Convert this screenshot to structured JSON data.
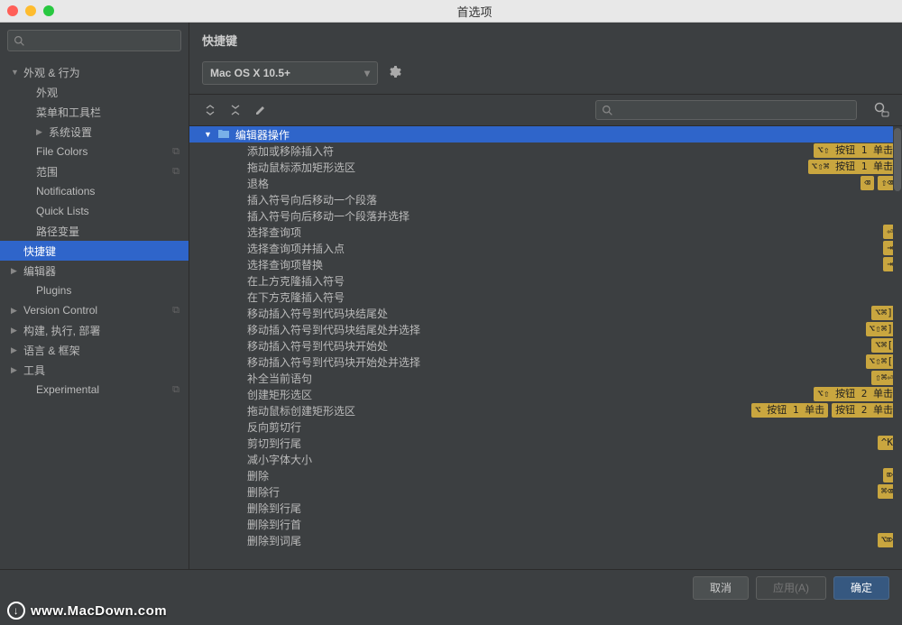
{
  "window": {
    "title": "首选项"
  },
  "sidebar": {
    "search_placeholder": "",
    "items": [
      {
        "label": "外观 & 行为",
        "arrow": "expanded",
        "level": 0
      },
      {
        "label": "外观",
        "level": 1
      },
      {
        "label": "菜单和工具栏",
        "level": 1
      },
      {
        "label": "系统设置",
        "arrow": "collapsed",
        "level": 1
      },
      {
        "label": "File Colors",
        "level": 1,
        "badge": "⧉"
      },
      {
        "label": "范围",
        "level": 1,
        "badge": "⧉"
      },
      {
        "label": "Notifications",
        "level": 1
      },
      {
        "label": "Quick Lists",
        "level": 1
      },
      {
        "label": "路径变量",
        "level": 1
      },
      {
        "label": "快捷键",
        "level": 0,
        "selected": true
      },
      {
        "label": "编辑器",
        "arrow": "collapsed",
        "level": 0
      },
      {
        "label": "Plugins",
        "level": 1
      },
      {
        "label": "Version Control",
        "arrow": "collapsed",
        "level": 0,
        "badge": "⧉"
      },
      {
        "label": "构建, 执行, 部署",
        "arrow": "collapsed",
        "level": 0
      },
      {
        "label": "语言 & 框架",
        "arrow": "collapsed",
        "level": 0
      },
      {
        "label": "工具",
        "arrow": "collapsed",
        "level": 0
      },
      {
        "label": "Experimental",
        "level": 1,
        "badge": "⧉"
      }
    ]
  },
  "content": {
    "title": "快捷键",
    "keymap_scheme": "Mac OS X 10.5+",
    "actions_search_placeholder": "",
    "group_label": "编辑器操作",
    "actions": [
      {
        "label": "添加或移除插入符",
        "shortcuts": [
          "⌥⇧ 按钮 1 单击"
        ]
      },
      {
        "label": "拖动鼠标添加矩形选区",
        "shortcuts": [
          "⌥⇧⌘ 按钮 1 单击"
        ]
      },
      {
        "label": "退格",
        "shortcuts": [
          "⌫",
          "⇧⌫"
        ]
      },
      {
        "label": "插入符号向后移动一个段落",
        "shortcuts": []
      },
      {
        "label": "插入符号向后移动一个段落并选择",
        "shortcuts": []
      },
      {
        "label": "选择查询项",
        "shortcuts": [
          "⏎"
        ]
      },
      {
        "label": "选择查询项并插入点",
        "shortcuts": [
          "⇥"
        ]
      },
      {
        "label": "选择查询项替换",
        "shortcuts": [
          "⇥"
        ]
      },
      {
        "label": "在上方克隆插入符号",
        "shortcuts": []
      },
      {
        "label": "在下方克隆插入符号",
        "shortcuts": []
      },
      {
        "label": "移动插入符号到代码块结尾处",
        "shortcuts": [
          "⌥⌘]"
        ]
      },
      {
        "label": "移动插入符号到代码块结尾处并选择",
        "shortcuts": [
          "⌥⇧⌘]"
        ]
      },
      {
        "label": "移动插入符号到代码块开始处",
        "shortcuts": [
          "⌥⌘["
        ]
      },
      {
        "label": "移动插入符号到代码块开始处并选择",
        "shortcuts": [
          "⌥⇧⌘["
        ]
      },
      {
        "label": "补全当前语句",
        "shortcuts": [
          "⇧⌘⏎"
        ]
      },
      {
        "label": "创建矩形选区",
        "shortcuts": [
          "⌥⇧ 按钮 2 单击"
        ]
      },
      {
        "label": "拖动鼠标创建矩形选区",
        "shortcuts": [
          "⌥ 按钮 1 单击",
          "按钮 2 单击"
        ]
      },
      {
        "label": "反向剪切行",
        "shortcuts": []
      },
      {
        "label": "剪切到行尾",
        "shortcuts": [
          "^K"
        ]
      },
      {
        "label": "减小字体大小",
        "shortcuts": []
      },
      {
        "label": "删除",
        "shortcuts": [
          "⌦"
        ]
      },
      {
        "label": "删除行",
        "shortcuts": [
          "⌘⌫"
        ]
      },
      {
        "label": "删除到行尾",
        "shortcuts": []
      },
      {
        "label": "删除到行首",
        "shortcuts": []
      },
      {
        "label": "删除到词尾",
        "shortcuts": [
          "⌥⌦"
        ]
      }
    ]
  },
  "footer": {
    "cancel": "取消",
    "apply": "应用(A)",
    "ok": "确定"
  },
  "watermark": "www.MacDown.com"
}
